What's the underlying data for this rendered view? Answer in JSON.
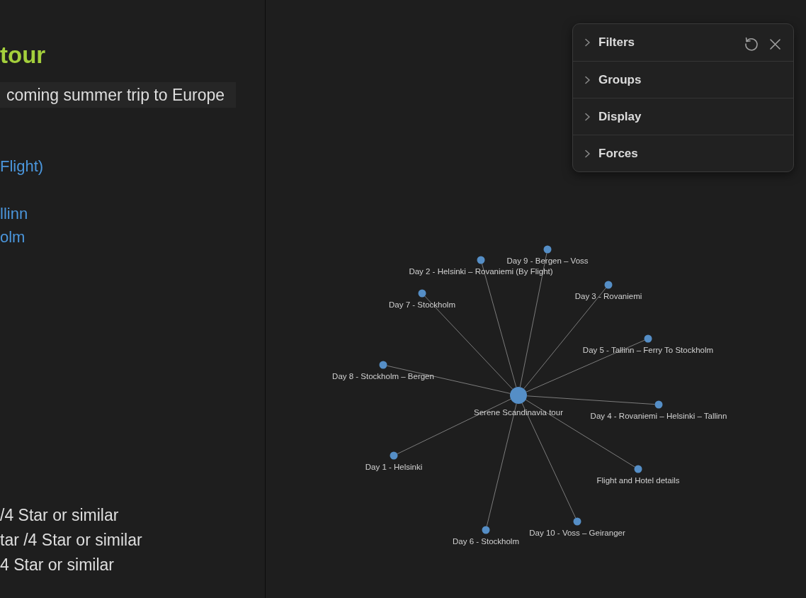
{
  "left_pane": {
    "heading": "tour",
    "intro": "coming summer trip to Europe",
    "links": [
      "Flight)",
      "llinn",
      "olm"
    ],
    "hotel_lines": [
      "/4 Star or similar",
      "tar /4 Star or similar",
      "4 Star or similar"
    ]
  },
  "graph_view": {
    "settings_panel": {
      "sections": [
        {
          "label": "Filters",
          "expanded": false
        },
        {
          "label": "Groups",
          "expanded": false
        },
        {
          "label": "Display",
          "expanded": false
        },
        {
          "label": "Forces",
          "expanded": false
        }
      ]
    },
    "graph": {
      "center": {
        "label": "Serene Scandinavia tour"
      },
      "nodes": [
        {
          "label": "Day 9 - Bergen – Voss"
        },
        {
          "label": "Day 2 - Helsinki – Rovaniemi (By Flight)"
        },
        {
          "label": "Day 3 - Rovaniemi"
        },
        {
          "label": "Day 7 - Stockholm"
        },
        {
          "label": "Day 5 - Tallinn – Ferry To Stockholm"
        },
        {
          "label": "Day 8 - Stockholm – Bergen"
        },
        {
          "label": "Day 4 - Rovaniemi – Helsinki – Tallinn"
        },
        {
          "label": "Day 1 - Helsinki"
        },
        {
          "label": "Flight and Hotel details"
        },
        {
          "label": "Day 10 - Voss – Geiranger"
        },
        {
          "label": "Day 6 - Stockholm"
        }
      ]
    }
  }
}
